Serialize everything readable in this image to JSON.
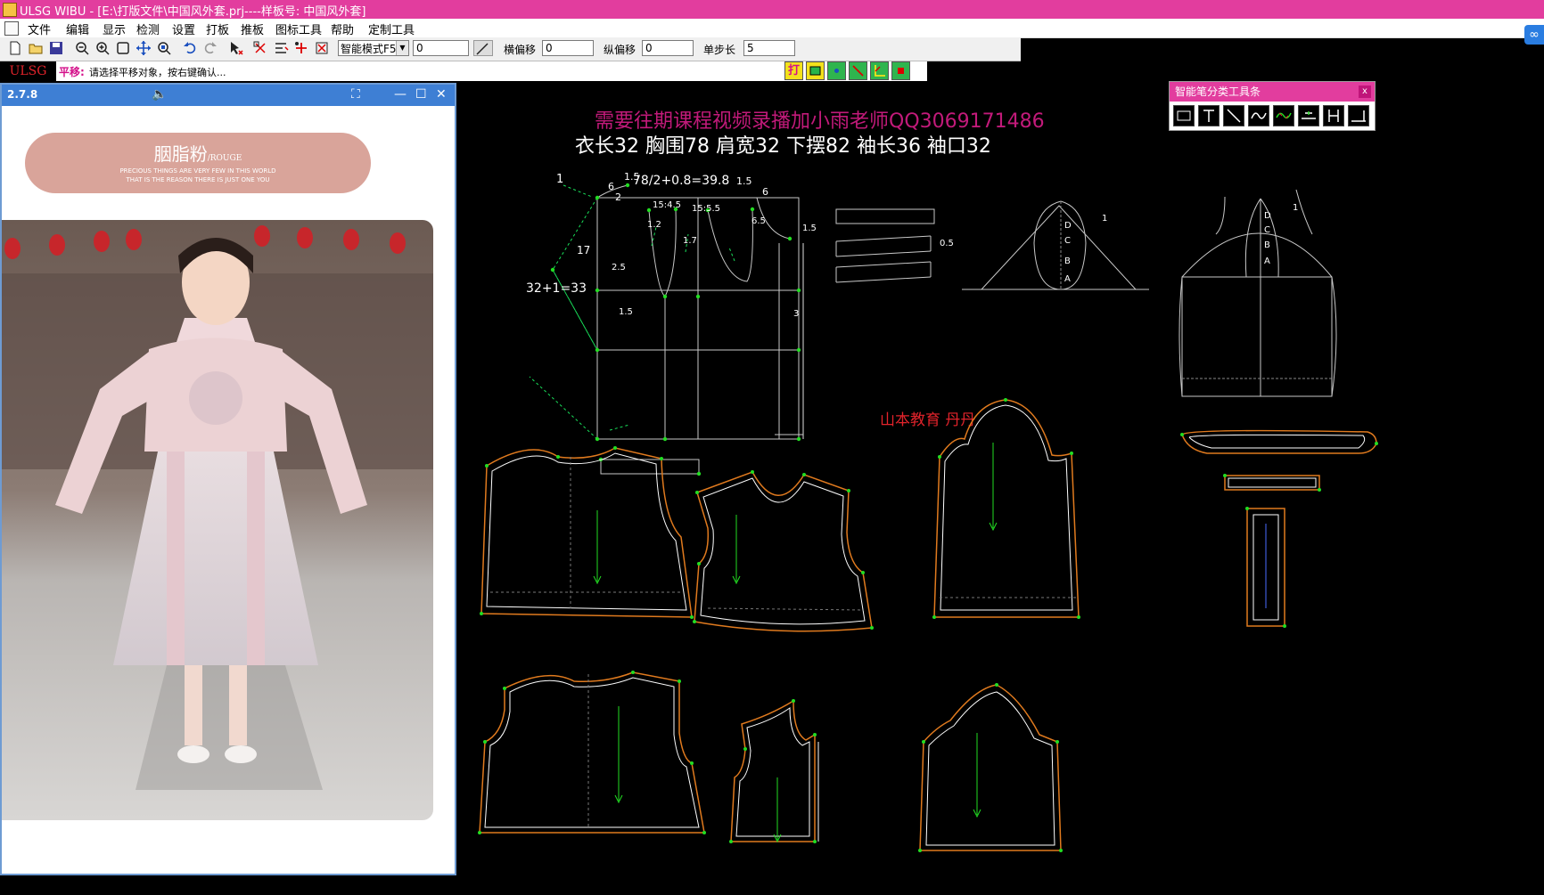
{
  "window": {
    "title": "ULSG WIBU - [E:\\打版文件\\中国风外套.prj----样板号: 中国风外套]"
  },
  "menu": {
    "items": [
      "文件",
      "编辑",
      "显示",
      "检测",
      "设置",
      "打板",
      "推板",
      "图标工具",
      "帮助",
      "定制工具"
    ]
  },
  "toolbar": {
    "mode_select": "智能模式F5",
    "value_field": "0",
    "h_offset_label": "横偏移",
    "h_offset_value": "0",
    "v_offset_label": "纵偏移",
    "v_offset_value": "0",
    "step_label": "单步长",
    "step_value": "5",
    "icons": [
      "new-file-icon",
      "open-folder-icon",
      "save-icon",
      "zoom-out-icon",
      "zoom-in-icon",
      "zoom-window-icon",
      "pan-icon",
      "zoom-fit-icon",
      "undo-icon",
      "redo-icon",
      "select-icon",
      "move-point-icon",
      "align-icon",
      "add-point-icon",
      "delete-point-icon"
    ]
  },
  "status": {
    "brand": "ULSG",
    "command": "平移:",
    "prompt": "请选择平移对象，按右键确认..."
  },
  "mini_tools": {
    "labels": [
      "打"
    ],
    "icons": [
      "print-icon",
      "rectangle-icon",
      "dot-icon",
      "line-icon",
      "axis-icon",
      "stop-icon"
    ]
  },
  "viewer": {
    "version": "2.7.8",
    "caption": "胭脂粉",
    "caption_sub": "/ROUGE",
    "caption_line1": "PRECIOUS THINGS ARE VERY FEW IN THIS WORLD",
    "caption_line2": "THAT IS THE REASON THERE IS JUST ONE YOU",
    "icons": [
      "volume-icon",
      "screenshot-icon",
      "minimize-icon",
      "maximize-icon",
      "close-icon"
    ]
  },
  "canvas": {
    "promo": "需要往期课程视频录播加小雨老师QQ3069171486",
    "measurements": "衣长32   胸围78   肩宽32   下摆82   袖长36   袖口32",
    "credit": "山本教育  丹丹",
    "labels": {
      "calc_chest": "78/2+0.8=39.8",
      "calc_hem": "32+1=33",
      "n1": "1",
      "n1_5a": "1.5",
      "n6a": "6",
      "n2": "2",
      "n1_5b": "1.5",
      "n6b": "6",
      "r15_4_5": "15:4.5",
      "r15_5_5": "15:5.5",
      "n6_5": "6.5",
      "n1_5c": "1.5",
      "n1_2": "1.2",
      "n1_7": "1.7",
      "n17": "17",
      "n2_5": "2.5",
      "n1_5d": "1.5",
      "n3": "3",
      "n0_5": "0.5",
      "n1b": "1",
      "n1c": "1",
      "D": "D",
      "C": "C",
      "B": "B",
      "A": "A",
      "D2": "D",
      "C2": "C",
      "B2": "B",
      "A2": "A"
    }
  },
  "smart_toolbar": {
    "title": "智能笔分类工具条",
    "close": "x",
    "buttons": [
      "rectangle-tool-icon",
      "text-tool-icon",
      "line-tool-icon",
      "curve-tool-icon",
      "smooth-tool-icon",
      "baseline-tool-icon",
      "h-tool-icon",
      "ruler-tool-icon"
    ]
  }
}
